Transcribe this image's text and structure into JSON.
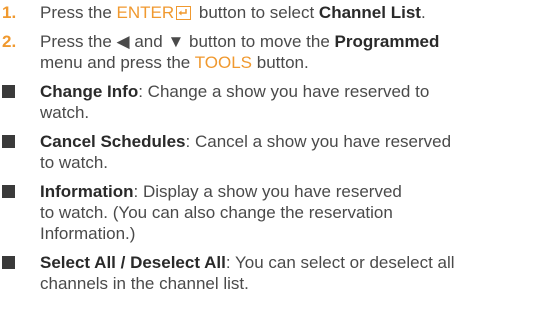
{
  "steps": [
    {
      "number": "1.",
      "t1": "Press the ",
      "key1": "ENTER",
      "t2": " button to select ",
      "bold1": "Channel List",
      "t3": "."
    },
    {
      "number": "2.",
      "t1": "Press the ",
      "arrow1": "◀",
      "t2": " and ",
      "arrow2": "▼",
      "t3": " button to move the ",
      "bold1": "Programmed",
      "t4": "menu and press the ",
      "key1": "TOOLS",
      "t5": " button."
    }
  ],
  "options": [
    {
      "title": "Change Info",
      "desc_line1": ": Change a show you have reserved to",
      "desc_line2": "watch."
    },
    {
      "title": "Cancel Schedules",
      "desc_line1": ": Cancel a show you have reserved",
      "desc_line2": "to watch."
    },
    {
      "title": "Information",
      "desc_line1": ": Display a show you have reserved",
      "desc_line2": "to watch. (You can also change the reservation",
      "desc_line3": "Information.)"
    },
    {
      "title": "Select All / Deselect All",
      "desc_line1": ": You can select or deselect all",
      "desc_line2": "channels in the channel list."
    }
  ],
  "icons": {
    "enter": "enter-icon",
    "left": "left-arrow-icon",
    "down": "down-arrow-icon",
    "bullet": "square-bullet-icon"
  },
  "colors": {
    "accent": "#f0992f",
    "text": "#4a4a4a",
    "bullet": "#3a3a3a"
  }
}
